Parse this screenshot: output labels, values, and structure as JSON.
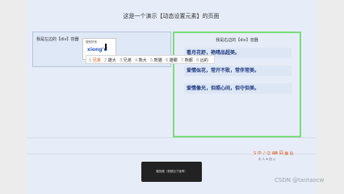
{
  "page": {
    "title": "这是一个演示【动态设置元素】的页面",
    "left_box_label": "我是左边的【div】容器",
    "right_box_label": "我是右边的【div】容器",
    "cards": [
      "看月花舒，艳晴品超美。",
      "爱情似花，常开不败，常伴常美。",
      "爱情像光，但照心间，但守但美。"
    ]
  },
  "ime": {
    "name": "搜狗拼音",
    "pinyin": "xiong'd",
    "candidates": [
      {
        "num": "1.",
        "text": "兄弟"
      },
      {
        "num": "2.",
        "text": "雄大"
      },
      {
        "num": "3.",
        "text": "兄弟"
      },
      {
        "num": "4.",
        "text": "熊大"
      },
      {
        "num": "5.",
        "text": "熊猫"
      },
      {
        "num": "6.",
        "text": "雄霸"
      },
      {
        "num": "7.",
        "text": "熊都"
      },
      {
        "num": "8.",
        "text": "凶的"
      }
    ]
  },
  "toast": {
    "text": "播放器（视频加了速率）"
  },
  "logo": {
    "text": "S 中 ♪ ☺ ⌨ 囧 ▦ ▤",
    "sub": "中  人  ⊕  田  ◎"
  },
  "watermark": "CSDN @taotaocw"
}
